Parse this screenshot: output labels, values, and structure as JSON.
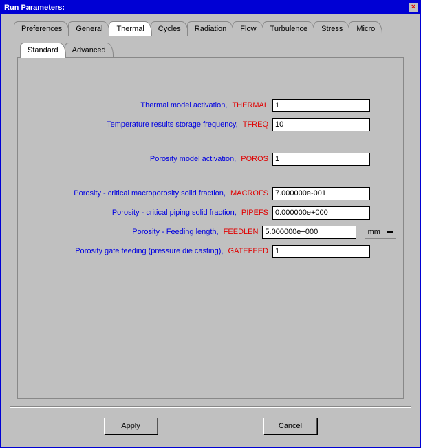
{
  "window": {
    "title": "Run Parameters:"
  },
  "mainTabs": {
    "items": [
      {
        "label": "Preferences"
      },
      {
        "label": "General"
      },
      {
        "label": "Thermal"
      },
      {
        "label": "Cycles"
      },
      {
        "label": "Radiation"
      },
      {
        "label": "Flow"
      },
      {
        "label": "Turbulence"
      },
      {
        "label": "Stress"
      },
      {
        "label": "Micro"
      }
    ],
    "activeIndex": 2
  },
  "subTabs": {
    "items": [
      {
        "label": "Standard"
      },
      {
        "label": "Advanced"
      }
    ],
    "activeIndex": 0
  },
  "fields": {
    "thermal": {
      "label": "Thermal model activation,",
      "code": "THERMAL",
      "value": "1"
    },
    "tfreq": {
      "label": "Temperature results storage frequency,",
      "code": "TFREQ",
      "value": "10"
    },
    "poros": {
      "label": "Porosity model activation,",
      "code": "POROS",
      "value": "1"
    },
    "macrofs": {
      "label": "Porosity - critical macroporosity solid fraction,",
      "code": "MACROFS",
      "value": "7.000000e-001"
    },
    "pipefs": {
      "label": "Porosity - critical piping solid fraction,",
      "code": "PIPEFS",
      "value": "0.000000e+000"
    },
    "feedlen": {
      "label": "Porosity - Feeding length,",
      "code": "FEEDLEN",
      "value": "5.000000e+000",
      "unit": "mm"
    },
    "gatefeed": {
      "label": "Porosity gate feeding (pressure die casting),",
      "code": "GATEFEED",
      "value": "1"
    }
  },
  "buttons": {
    "apply": "Apply",
    "cancel": "Cancel"
  }
}
